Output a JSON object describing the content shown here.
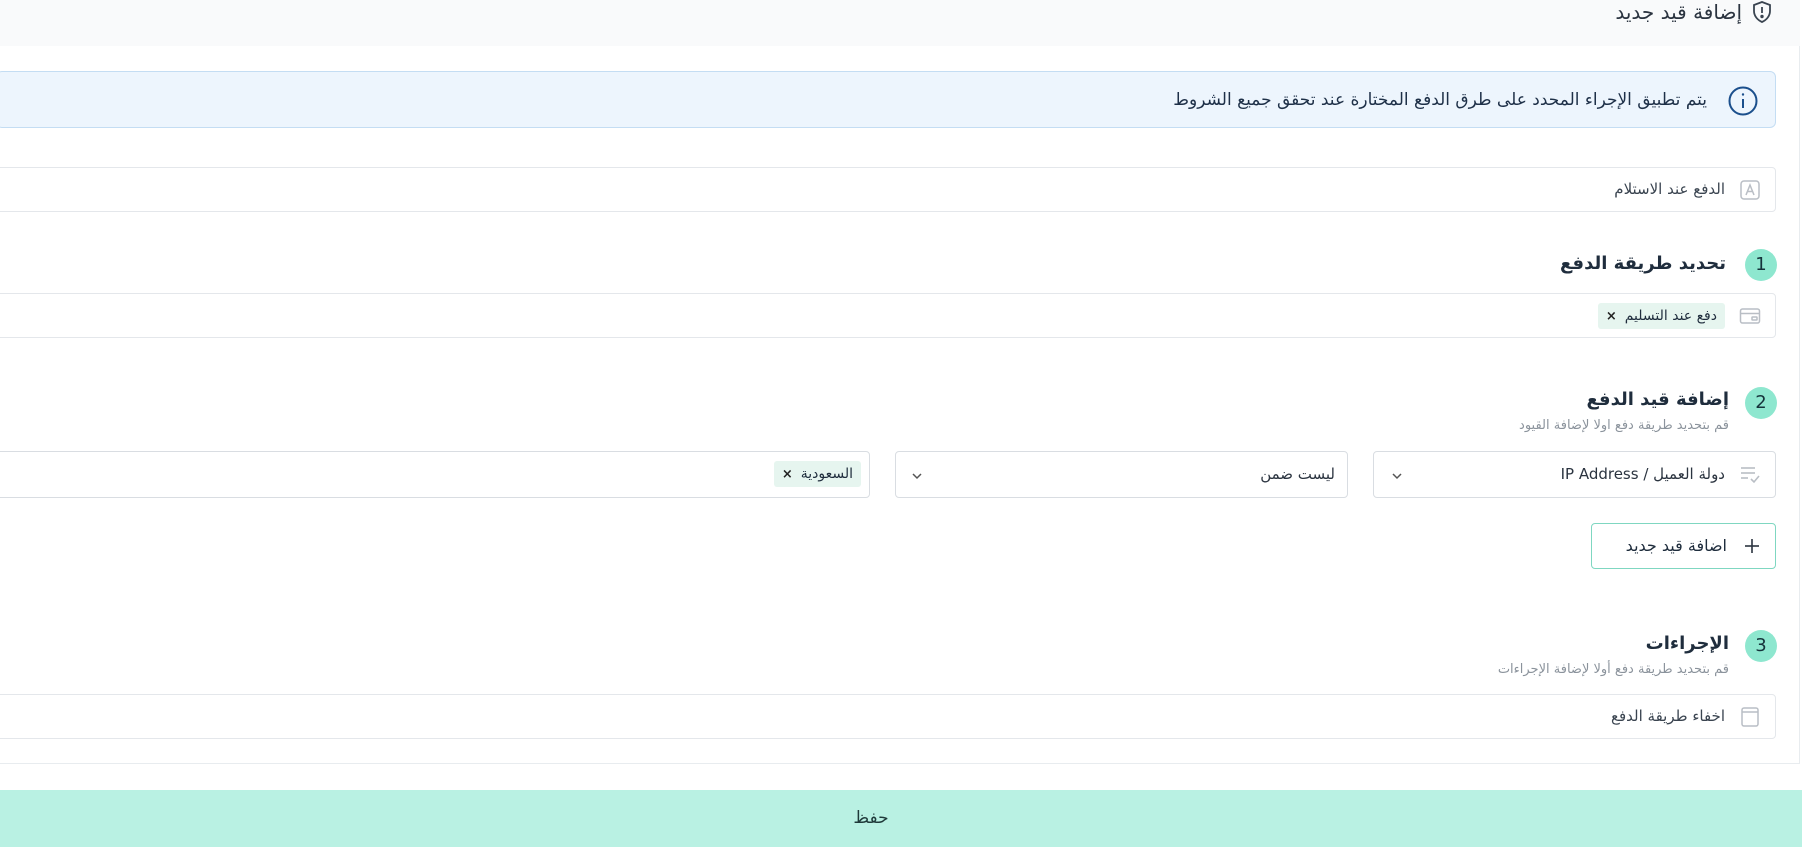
{
  "header": {
    "title": "إضافة قيد جديد",
    "icon": "shield-alert-icon"
  },
  "info": {
    "text": "يتم تطبيق الإجراء المحدد على طرق الدفع المختارة عند تحقق جميع الشروط",
    "icon": "info-circle-icon",
    "bg_color": "#edf5fd"
  },
  "rule_name": {
    "value": "الدفع عند الاستلام",
    "icon": "text-field-icon"
  },
  "step1": {
    "number": "1",
    "title": "تحديد طريقة الدفع",
    "selected_chip": "دفع عند التسليم",
    "icon": "credit-card-icon"
  },
  "step2": {
    "number": "2",
    "title": "إضافة قيد الدفع",
    "subtitle": "قم بتحديد طريقة دفع اولا لإضافة القيود",
    "condition": {
      "field": "دولة العميل / IP Address",
      "operator": "ليست ضمن",
      "value_chip": "السعودية"
    },
    "add_button_label": "اضافة قيد جديد"
  },
  "step3": {
    "number": "3",
    "title": "الإجراءات",
    "subtitle": "قم بتحديد طريقة دفع أولا لإضافة الإجراءات",
    "action_value": "اخفاء طريقة الدفع",
    "icon": "document-icon"
  },
  "footer": {
    "save_label": "حفظ",
    "bg_color": "#b9f1e3"
  },
  "colors": {
    "accent": "#8ee7cf",
    "accent_border": "#7fd7c1",
    "chip_bg": "#e6f5ef"
  }
}
